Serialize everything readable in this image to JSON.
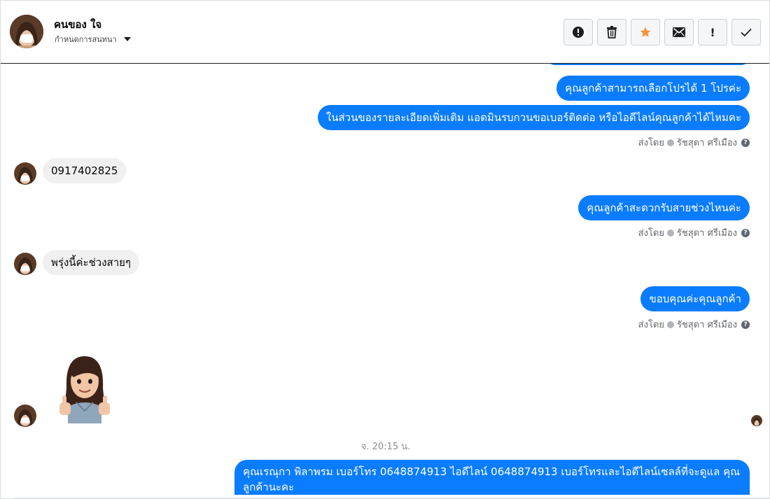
{
  "header": {
    "contact_name": "คนของ ใจ",
    "assign_label": "กำหนดการสนทนา",
    "toolbar": [
      {
        "name": "spam-button",
        "icon": "exclamation-circle-icon"
      },
      {
        "name": "delete-button",
        "icon": "trash-icon"
      },
      {
        "name": "star-button",
        "icon": "star-icon",
        "color": "#f7923b"
      },
      {
        "name": "mark-unread-button",
        "icon": "envelope-icon"
      },
      {
        "name": "follow-up-button",
        "icon": "exclamation-icon",
        "label": "!"
      },
      {
        "name": "done-button",
        "icon": "check-icon"
      }
    ]
  },
  "messages": {
    "out_1": "คุณลูกค้าสามารถเลือกโปรได้ 1 โปรค่ะ",
    "out_2": "ในส่วนของรายละเอียดเพิ่มเติม แอดมินรบกวนขอเบอร์ติดต่อ หรือไอดีไลน์คุณลูกค้าได้ไหมคะ",
    "in_1": "0917402825",
    "out_3": "คุณลูกค้าสะดวกรับสายช่วงไหนค่ะ",
    "in_2": "พรุ่งนี้ค่ะช่วงสายๆ",
    "out_4": "ขอบคุณค่ะคุณลูกค้า",
    "sticker": "thumbs-up-avatar-sticker",
    "timestamp": "จ. 20:15 น.",
    "out_5": "คุณเรณุกา พิลาพรม        เบอร์โทร 0648874913  ไอดีไลน์ 0648874913   เบอร์โทรและไอดีไลน์เซลล์ที่จะดูแล คุณลูกค้านะคะ"
  },
  "sent_by": {
    "prefix": "ส่งโดย",
    "name": "รัชสุดา ศรีเมือง",
    "help_icon": "?"
  },
  "colors": {
    "outgoing_bubble": "#0a7cff",
    "incoming_bubble": "#f0f0f0",
    "star": "#f7923b"
  }
}
